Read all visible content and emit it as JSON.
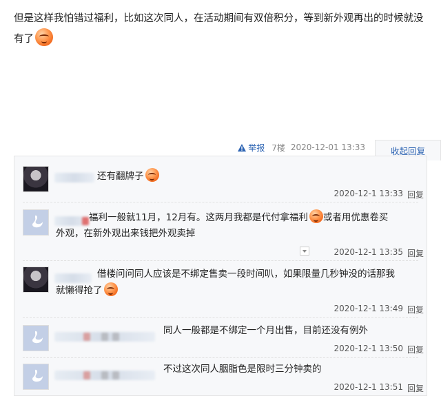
{
  "post": {
    "text_line1": "但是这样我怕错过福利，比如这次同人，在活动期间有双倍积分，等到新外观再出的时候就没",
    "text_line2": "有了",
    "emoji_icon": "laughing-emoji-icon",
    "report_label": "举报",
    "floor": "7楼",
    "time": "2020-12-01 13:33",
    "collapse_label": "收起回复"
  },
  "replies": [
    {
      "avatar": "dark",
      "text": "还有翻牌子",
      "emoji": true,
      "time": "2020-12-1 13:33",
      "reply_label": "回复"
    },
    {
      "avatar": "swan",
      "text_line1": "福利一般就11月，12月有。这两月我都是代付拿福利",
      "text_line1b": "或者用优惠卷买",
      "text_line2": "外观，在新外观出来钱把外观卖掉",
      "time": "2020-12-1 13:35",
      "reply_label": "回复"
    },
    {
      "avatar": "dark",
      "text_line1": "借楼问问同人应该是不绑定售卖一段时间叭，如果限量几秒钟没的话那我",
      "text_line2": "就懒得抢了",
      "time": "2020-12-1 13:49",
      "reply_label": "回复"
    },
    {
      "avatar": "swan",
      "text": "同人一般都是不绑定一个月出售，目前还没有例外",
      "time": "2020-12-1 13:50",
      "reply_label": "回复"
    },
    {
      "avatar": "swan",
      "text": "不过这次同人胭脂色是限时三分钟卖的",
      "time": "2020-12-1 13:51",
      "reply_label": "回复"
    }
  ],
  "colors": {
    "link": "#2d64b3",
    "panel_bg": "#f7f8fa",
    "border": "#e4e4e4"
  }
}
